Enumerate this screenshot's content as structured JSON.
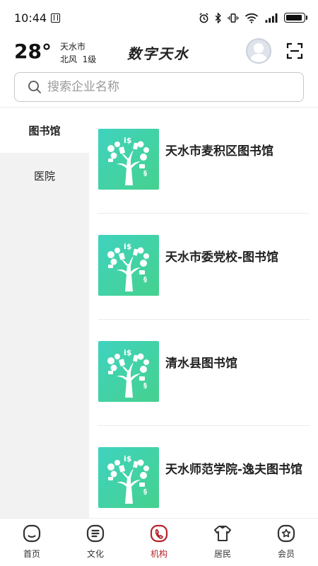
{
  "status_bar": {
    "time": "10:44",
    "battery_level": 0.9
  },
  "header": {
    "temperature": "28°",
    "city": "天水市",
    "wind": "北风  1级",
    "title": "数字天水"
  },
  "search": {
    "placeholder": "搜索企业名称"
  },
  "sidebar": {
    "items": [
      {
        "label": "图书馆",
        "active": true
      },
      {
        "label": "医院",
        "active": false
      }
    ]
  },
  "list": {
    "items": [
      {
        "title": "天水市麦积区图书馆"
      },
      {
        "title": "天水市委党校-图书馆"
      },
      {
        "title": "清水县图书馆"
      },
      {
        "title": "天水师范学院-逸夫图书馆"
      }
    ]
  },
  "bottom_nav": {
    "items": [
      {
        "label": "首页",
        "icon": "home-icon",
        "active": false
      },
      {
        "label": "文化",
        "icon": "culture-icon",
        "active": false
      },
      {
        "label": "机构",
        "icon": "institution-icon",
        "active": true
      },
      {
        "label": "居民",
        "icon": "resident-icon",
        "active": false
      },
      {
        "label": "会员",
        "icon": "member-icon",
        "active": false
      }
    ]
  },
  "colors": {
    "accent": "#b3242b",
    "thumb_gradient_start": "#3fd3bf",
    "thumb_gradient_end": "#45d18e",
    "sidebar_bg": "#f2f2f2"
  }
}
